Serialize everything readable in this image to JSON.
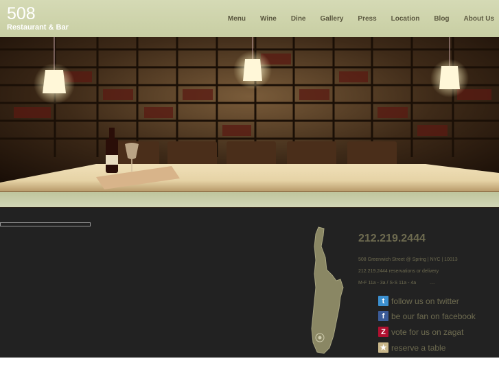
{
  "header": {
    "logo_number": "508",
    "logo_subtitle": "Restaurant & Bar"
  },
  "nav": {
    "items": [
      {
        "label": "Menu"
      },
      {
        "label": "Wine"
      },
      {
        "label": "Dine"
      },
      {
        "label": "Gallery"
      },
      {
        "label": "Press"
      },
      {
        "label": "Location"
      },
      {
        "label": "Blog"
      },
      {
        "label": "About Us"
      }
    ]
  },
  "hero": {
    "scene": "wine-bar-counter-photo"
  },
  "contact": {
    "phone": "212.219.2444",
    "address": "508 Greenwich Street @ Spring | NYC | 10013",
    "reservations": "212.219.2444 reservations or delivery",
    "hours": "M-F 11a - 3a / S-S 11a - 4a",
    "hours_more": "...."
  },
  "social": [
    {
      "label": "follow us on twitter",
      "icon": "twitter-icon",
      "color": "#3b8fcf"
    },
    {
      "label": "be our fan on facebook",
      "icon": "facebook-icon",
      "color": "#3b5b98"
    },
    {
      "label": "vote for us on zagat",
      "icon": "zagat-icon",
      "color": "#b01030"
    },
    {
      "label": "reserve a table",
      "icon": "opentable-icon",
      "color": "#c9b78a"
    }
  ],
  "colors": {
    "header": "#d0d5ae",
    "footer": "#222222",
    "text_muted": "#6e6b50"
  }
}
